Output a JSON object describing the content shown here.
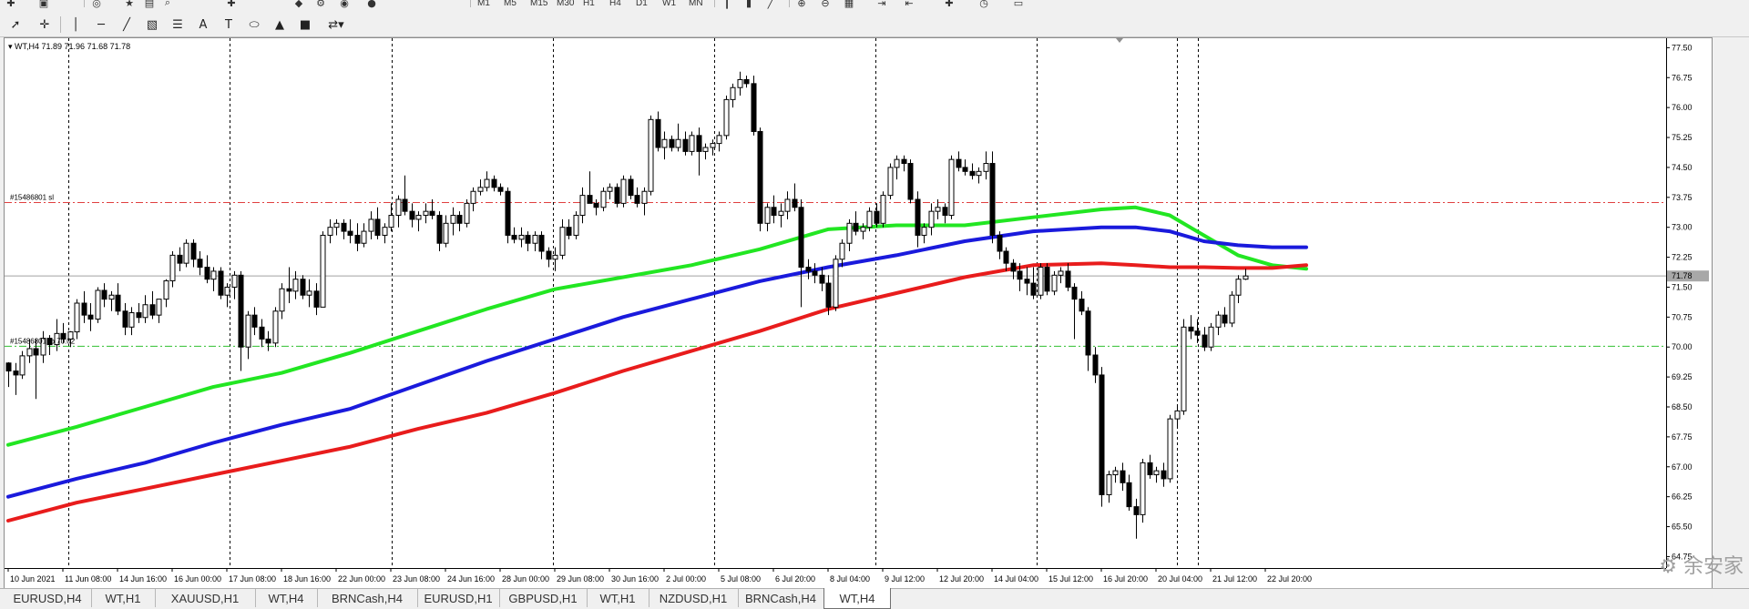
{
  "chart": {
    "symbol_header": "WT,H4  71.89 71.96 71.68 71.78",
    "current_price": "71.78",
    "order_labels": {
      "sl": "#15486801 sl",
      "tp": "#15486801 tp 70.02"
    },
    "price_axis": [
      "77.50",
      "76.75",
      "76.00",
      "75.25",
      "74.50",
      "73.75",
      "73.00",
      "72.25",
      "71.50",
      "70.75",
      "70.00",
      "69.25",
      "68.50",
      "67.75",
      "67.00",
      "66.25",
      "65.50",
      "64.75"
    ],
    "time_axis": [
      "10 Jun 2021",
      "11 Jun 08:00",
      "14 Jun 16:00",
      "16 Jun 00:00",
      "17 Jun 08:00",
      "18 Jun 16:00",
      "22 Jun 00:00",
      "23 Jun 08:00",
      "24 Jun 16:00",
      "28 Jun 00:00",
      "29 Jun 08:00",
      "30 Jun 16:00",
      "2 Jul 00:00",
      "5 Jul 08:00",
      "6 Jul 20:00",
      "8 Jul 04:00",
      "9 Jul 12:00",
      "12 Jul 20:00",
      "14 Jul 04:00",
      "15 Jul 12:00",
      "16 Jul 20:00",
      "20 Jul 04:00",
      "21 Jul 12:00",
      "22 Jul 20:00"
    ],
    "colors": {
      "ma_fast": "#22e622",
      "ma_mid": "#1a1adc",
      "ma_slow": "#e81c1c",
      "sl_line": "#e04040",
      "tp_line": "#30c030",
      "price_line": "#a0a0a0"
    }
  },
  "chart_data": {
    "type": "candlestick",
    "symbol": "WT",
    "timeframe": "H4",
    "ylim": [
      64.6,
      77.6
    ],
    "current_price": 71.78,
    "levels": {
      "sl": 73.62,
      "tp": 70.02
    },
    "candles": [
      [
        69.6,
        69.62,
        69.0,
        69.4
      ],
      [
        69.4,
        69.6,
        68.8,
        69.3
      ],
      [
        69.3,
        69.9,
        69.2,
        69.78
      ],
      [
        69.78,
        70.2,
        69.6,
        69.96
      ],
      [
        69.96,
        70.2,
        68.7,
        69.8
      ],
      [
        69.8,
        70.4,
        69.6,
        70.22
      ],
      [
        70.22,
        70.3,
        69.8,
        70.06
      ],
      [
        70.06,
        70.7,
        69.9,
        70.34
      ],
      [
        70.34,
        70.6,
        70.1,
        70.2
      ],
      [
        70.2,
        70.4,
        70.0,
        70.38
      ],
      [
        70.38,
        71.2,
        70.2,
        71.1
      ],
      [
        71.1,
        71.4,
        70.6,
        70.8
      ],
      [
        70.8,
        71.1,
        70.4,
        70.7
      ],
      [
        70.7,
        71.5,
        70.6,
        71.42
      ],
      [
        71.42,
        71.6,
        71.0,
        71.2
      ],
      [
        71.2,
        71.4,
        70.9,
        71.3
      ],
      [
        71.3,
        71.6,
        70.8,
        70.9
      ],
      [
        70.9,
        71.1,
        70.3,
        70.5
      ],
      [
        70.5,
        71.0,
        70.3,
        70.86
      ],
      [
        70.86,
        71.1,
        70.6,
        70.74
      ],
      [
        70.74,
        71.3,
        70.6,
        71.06
      ],
      [
        71.06,
        71.4,
        70.7,
        70.8
      ],
      [
        70.8,
        71.2,
        70.6,
        71.2
      ],
      [
        71.2,
        71.7,
        71.0,
        71.66
      ],
      [
        71.66,
        72.4,
        71.5,
        72.3
      ],
      [
        72.3,
        72.5,
        71.9,
        72.1
      ],
      [
        72.1,
        72.7,
        72.0,
        72.6
      ],
      [
        72.6,
        72.7,
        72.0,
        72.2
      ],
      [
        72.2,
        72.4,
        71.8,
        72.0
      ],
      [
        72.0,
        72.3,
        71.6,
        71.7
      ],
      [
        71.7,
        72.0,
        71.4,
        71.9
      ],
      [
        71.9,
        72.0,
        71.2,
        71.3
      ],
      [
        71.3,
        71.6,
        71.0,
        71.5
      ],
      [
        71.5,
        71.9,
        71.2,
        71.8
      ],
      [
        71.8,
        71.9,
        69.4,
        70.0
      ],
      [
        70.0,
        70.9,
        69.7,
        70.8
      ],
      [
        70.8,
        71.0,
        70.3,
        70.5
      ],
      [
        70.5,
        70.7,
        70.0,
        70.2
      ],
      [
        70.2,
        70.4,
        69.9,
        70.1
      ],
      [
        70.1,
        71.0,
        70.0,
        70.9
      ],
      [
        70.9,
        71.6,
        70.7,
        71.46
      ],
      [
        71.46,
        72.0,
        71.1,
        71.4
      ],
      [
        71.4,
        71.9,
        71.2,
        71.7
      ],
      [
        71.7,
        71.8,
        71.2,
        71.3
      ],
      [
        71.3,
        71.7,
        71.0,
        71.4
      ],
      [
        71.4,
        71.6,
        70.8,
        71.0
      ],
      [
        71.0,
        72.9,
        71.0,
        72.8
      ],
      [
        72.8,
        73.2,
        72.6,
        73.0
      ],
      [
        73.0,
        73.2,
        72.8,
        73.1
      ],
      [
        73.1,
        73.2,
        72.7,
        72.9
      ],
      [
        72.9,
        73.2,
        72.6,
        72.8
      ],
      [
        72.8,
        73.1,
        72.4,
        72.6
      ],
      [
        72.6,
        73.1,
        72.5,
        72.9
      ],
      [
        72.9,
        73.4,
        72.7,
        73.2
      ],
      [
        73.2,
        73.5,
        72.7,
        72.8
      ],
      [
        72.8,
        73.1,
        72.6,
        73.0
      ],
      [
        73.0,
        73.6,
        72.9,
        73.3
      ],
      [
        73.3,
        73.8,
        73.0,
        73.7
      ],
      [
        73.7,
        74.3,
        73.3,
        73.4
      ],
      [
        73.4,
        73.6,
        73.0,
        73.2
      ],
      [
        73.2,
        73.4,
        72.9,
        73.3
      ],
      [
        73.3,
        73.6,
        73.1,
        73.4
      ],
      [
        73.4,
        73.7,
        73.2,
        73.3
      ],
      [
        73.3,
        73.4,
        72.4,
        72.6
      ],
      [
        72.6,
        73.3,
        72.5,
        73.1
      ],
      [
        73.1,
        73.5,
        72.8,
        73.3
      ],
      [
        73.3,
        73.4,
        72.9,
        73.1
      ],
      [
        73.1,
        73.7,
        73.0,
        73.6
      ],
      [
        73.6,
        74.0,
        73.4,
        73.9
      ],
      [
        73.9,
        74.2,
        73.8,
        74.0
      ],
      [
        74.0,
        74.4,
        73.9,
        74.2
      ],
      [
        74.2,
        74.3,
        73.9,
        74.0
      ],
      [
        74.0,
        74.1,
        73.8,
        73.9
      ],
      [
        73.9,
        74.0,
        72.6,
        72.8
      ],
      [
        72.8,
        73.0,
        72.6,
        72.7
      ],
      [
        72.7,
        73.0,
        72.5,
        72.8
      ],
      [
        72.8,
        72.9,
        72.4,
        72.6
      ],
      [
        72.6,
        72.9,
        72.4,
        72.8
      ],
      [
        72.8,
        72.9,
        72.2,
        72.4
      ],
      [
        72.4,
        72.5,
        72.0,
        72.2
      ],
      [
        72.2,
        72.5,
        71.9,
        72.3
      ],
      [
        72.3,
        73.2,
        72.2,
        73.0
      ],
      [
        73.0,
        73.2,
        72.7,
        72.8
      ],
      [
        72.8,
        73.4,
        72.7,
        73.3
      ],
      [
        73.3,
        74.0,
        73.1,
        73.8
      ],
      [
        73.8,
        74.4,
        73.6,
        73.6
      ],
      [
        73.6,
        73.7,
        73.3,
        73.5
      ],
      [
        73.5,
        74.0,
        73.4,
        73.9
      ],
      [
        73.9,
        74.1,
        73.7,
        74.0
      ],
      [
        74.0,
        74.1,
        73.5,
        73.6
      ],
      [
        73.6,
        74.3,
        73.5,
        74.2
      ],
      [
        74.2,
        74.3,
        73.7,
        73.8
      ],
      [
        73.8,
        74.0,
        73.5,
        73.6
      ],
      [
        73.6,
        74.0,
        73.3,
        73.9
      ],
      [
        73.9,
        75.8,
        73.8,
        75.7
      ],
      [
        75.7,
        75.9,
        74.9,
        75.0
      ],
      [
        75.0,
        75.4,
        74.7,
        75.2
      ],
      [
        75.2,
        75.3,
        74.9,
        75.0
      ],
      [
        75.0,
        75.6,
        74.9,
        75.2
      ],
      [
        75.2,
        75.4,
        74.8,
        74.9
      ],
      [
        74.9,
        75.4,
        74.8,
        75.3
      ],
      [
        75.3,
        75.5,
        74.3,
        74.9
      ],
      [
        74.9,
        75.1,
        74.7,
        75.0
      ],
      [
        75.0,
        75.2,
        74.8,
        75.1
      ],
      [
        75.1,
        75.4,
        74.9,
        75.3
      ],
      [
        75.3,
        76.3,
        75.2,
        76.2
      ],
      [
        76.2,
        76.6,
        76.0,
        76.5
      ],
      [
        76.5,
        76.9,
        76.3,
        76.7
      ],
      [
        76.7,
        76.8,
        76.5,
        76.6
      ],
      [
        76.6,
        76.8,
        75.3,
        75.4
      ],
      [
        75.4,
        75.5,
        72.9,
        73.1
      ],
      [
        73.1,
        73.6,
        72.9,
        73.5
      ],
      [
        73.5,
        73.8,
        73.1,
        73.3
      ],
      [
        73.3,
        73.6,
        73.0,
        73.4
      ],
      [
        73.4,
        73.9,
        73.2,
        73.7
      ],
      [
        73.7,
        74.1,
        73.4,
        73.5
      ],
      [
        73.5,
        73.7,
        71.0,
        72.0
      ],
      [
        72.0,
        72.2,
        71.7,
        71.9
      ],
      [
        71.9,
        72.1,
        71.6,
        71.8
      ],
      [
        71.8,
        72.0,
        71.4,
        71.6
      ],
      [
        71.6,
        71.8,
        70.8,
        71.0
      ],
      [
        71.0,
        72.3,
        70.9,
        72.2
      ],
      [
        72.2,
        72.7,
        72.0,
        72.6
      ],
      [
        72.6,
        73.2,
        72.4,
        73.1
      ],
      [
        73.1,
        73.4,
        72.8,
        72.9
      ],
      [
        72.9,
        73.1,
        72.7,
        73.0
      ],
      [
        73.0,
        73.5,
        72.9,
        73.4
      ],
      [
        73.4,
        73.6,
        73.0,
        73.1
      ],
      [
        73.1,
        73.9,
        73.0,
        73.8
      ],
      [
        73.8,
        74.6,
        73.7,
        74.5
      ],
      [
        74.5,
        74.8,
        74.2,
        74.7
      ],
      [
        74.7,
        74.8,
        74.4,
        74.6
      ],
      [
        74.6,
        74.7,
        73.6,
        73.7
      ],
      [
        73.7,
        73.9,
        72.5,
        72.8
      ],
      [
        72.8,
        73.1,
        72.6,
        73.0
      ],
      [
        73.0,
        73.6,
        72.8,
        73.4
      ],
      [
        73.4,
        73.7,
        73.2,
        73.5
      ],
      [
        73.5,
        73.6,
        73.1,
        73.3
      ],
      [
        73.3,
        74.8,
        73.2,
        74.7
      ],
      [
        74.7,
        74.9,
        74.4,
        74.5
      ],
      [
        74.5,
        74.7,
        74.3,
        74.4
      ],
      [
        74.4,
        74.6,
        74.2,
        74.3
      ],
      [
        74.3,
        74.5,
        74.1,
        74.4
      ],
      [
        74.4,
        74.9,
        74.2,
        74.6
      ],
      [
        74.6,
        74.9,
        72.6,
        72.8
      ],
      [
        72.8,
        72.9,
        72.2,
        72.4
      ],
      [
        72.4,
        72.5,
        71.9,
        72.1
      ],
      [
        72.1,
        72.2,
        71.7,
        71.9
      ],
      [
        71.9,
        72.1,
        71.4,
        71.7
      ],
      [
        71.7,
        72.0,
        71.3,
        71.6
      ],
      [
        71.6,
        72.0,
        71.2,
        71.3
      ],
      [
        71.3,
        72.1,
        71.2,
        72.0
      ],
      [
        72.0,
        72.1,
        71.3,
        71.4
      ],
      [
        71.4,
        71.9,
        71.3,
        71.8
      ],
      [
        71.8,
        72.0,
        71.6,
        71.9
      ],
      [
        71.9,
        72.1,
        71.4,
        71.5
      ],
      [
        71.5,
        71.6,
        70.2,
        71.2
      ],
      [
        71.2,
        71.4,
        70.8,
        70.9
      ],
      [
        70.9,
        71.0,
        69.4,
        69.8
      ],
      [
        69.8,
        70.0,
        69.1,
        69.3
      ],
      [
        69.3,
        69.5,
        66.0,
        66.3
      ],
      [
        66.3,
        66.9,
        66.1,
        66.8
      ],
      [
        66.8,
        67.0,
        66.6,
        66.9
      ],
      [
        66.9,
        67.1,
        66.4,
        66.6
      ],
      [
        66.6,
        66.8,
        65.9,
        66.0
      ],
      [
        66.0,
        66.2,
        65.2,
        65.8
      ],
      [
        65.8,
        67.2,
        65.6,
        67.1
      ],
      [
        67.1,
        67.3,
        66.7,
        66.8
      ],
      [
        66.8,
        67.0,
        66.6,
        66.9
      ],
      [
        66.9,
        67.1,
        66.5,
        66.7
      ],
      [
        66.7,
        68.3,
        66.6,
        68.2
      ],
      [
        68.2,
        68.5,
        68.0,
        68.4
      ],
      [
        68.4,
        70.7,
        68.3,
        70.5
      ],
      [
        70.5,
        70.8,
        70.2,
        70.4
      ],
      [
        70.4,
        70.7,
        70.1,
        70.3
      ],
      [
        70.3,
        70.5,
        69.9,
        70.0
      ],
      [
        70.0,
        70.6,
        69.9,
        70.5
      ],
      [
        70.5,
        70.9,
        70.3,
        70.8
      ],
      [
        70.8,
        71.0,
        70.5,
        70.6
      ],
      [
        70.6,
        71.4,
        70.5,
        71.3
      ],
      [
        71.3,
        71.8,
        71.1,
        71.7
      ],
      [
        71.7,
        71.96,
        71.68,
        71.78
      ]
    ],
    "series": [
      {
        "color": "#22e622",
        "points": [
          [
            0,
            67.55
          ],
          [
            10,
            68.0
          ],
          [
            20,
            68.5
          ],
          [
            30,
            69.0
          ],
          [
            40,
            69.35
          ],
          [
            50,
            69.85
          ],
          [
            60,
            70.4
          ],
          [
            70,
            70.95
          ],
          [
            80,
            71.45
          ],
          [
            90,
            71.75
          ],
          [
            100,
            72.05
          ],
          [
            110,
            72.45
          ],
          [
            120,
            72.95
          ],
          [
            130,
            73.05
          ],
          [
            140,
            73.05
          ],
          [
            150,
            73.25
          ],
          [
            160,
            73.45
          ],
          [
            165,
            73.5
          ],
          [
            170,
            73.3
          ],
          [
            175,
            72.8
          ],
          [
            180,
            72.3
          ],
          [
            185,
            72.05
          ],
          [
            190,
            71.96
          ]
        ]
      },
      {
        "color": "#1a1adc",
        "points": [
          [
            0,
            66.25
          ],
          [
            10,
            66.7
          ],
          [
            20,
            67.1
          ],
          [
            30,
            67.6
          ],
          [
            40,
            68.05
          ],
          [
            50,
            68.45
          ],
          [
            60,
            69.05
          ],
          [
            70,
            69.65
          ],
          [
            80,
            70.2
          ],
          [
            90,
            70.75
          ],
          [
            100,
            71.2
          ],
          [
            110,
            71.65
          ],
          [
            120,
            72.0
          ],
          [
            130,
            72.3
          ],
          [
            140,
            72.65
          ],
          [
            150,
            72.9
          ],
          [
            160,
            73.0
          ],
          [
            165,
            73.0
          ],
          [
            170,
            72.9
          ],
          [
            175,
            72.65
          ],
          [
            180,
            72.55
          ],
          [
            185,
            72.5
          ],
          [
            190,
            72.5
          ]
        ]
      },
      {
        "color": "#e81c1c",
        "points": [
          [
            0,
            65.65
          ],
          [
            10,
            66.1
          ],
          [
            20,
            66.45
          ],
          [
            30,
            66.8
          ],
          [
            40,
            67.15
          ],
          [
            50,
            67.5
          ],
          [
            60,
            67.95
          ],
          [
            70,
            68.35
          ],
          [
            80,
            68.85
          ],
          [
            90,
            69.4
          ],
          [
            100,
            69.9
          ],
          [
            110,
            70.4
          ],
          [
            120,
            70.95
          ],
          [
            130,
            71.35
          ],
          [
            140,
            71.75
          ],
          [
            150,
            72.05
          ],
          [
            160,
            72.1
          ],
          [
            165,
            72.05
          ],
          [
            170,
            72.0
          ],
          [
            175,
            72.0
          ],
          [
            180,
            71.98
          ],
          [
            185,
            71.98
          ],
          [
            190,
            72.05
          ]
        ]
      }
    ]
  },
  "tabs": [
    "EURUSD,H4",
    "WT,H1",
    "XAUUSD,H1",
    "WT,H4",
    "BRNCash,H4",
    "EURUSD,H1",
    "GBPUSD,H1",
    "WT,H1",
    "NZDUSD,H1",
    "BRNCash,H4",
    "WT,H4"
  ],
  "active_tab": 10,
  "timeframes": [
    "M1",
    "M5",
    "M15",
    "M30",
    "H1",
    "H4",
    "D1",
    "W1",
    "MN"
  ],
  "watermark": "⚙ 余安家"
}
